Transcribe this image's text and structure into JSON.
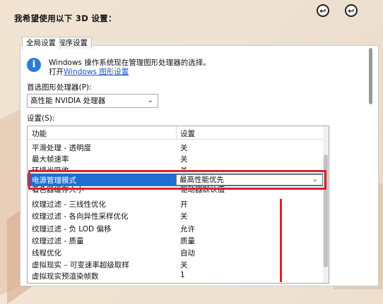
{
  "header": {
    "title": "我希望使用以下 3D 设置："
  },
  "tabs": [
    {
      "label": "全局设置",
      "active": true
    },
    {
      "label": "程序设置",
      "active": false
    }
  ],
  "info": {
    "line1": "Windows 操作系统现在管理图形处理器的选择。",
    "line2_prefix": "打开",
    "line2_link": "Windows 图形设置"
  },
  "preferred_gpu": {
    "label": "首选图形处理器(P):",
    "value": "高性能 NVIDIA 处理器"
  },
  "settings": {
    "label": "设置(S):",
    "col_feature": "功能",
    "col_setting": "设置",
    "rows": [
      {
        "feature": "平滑处理 - 透明度",
        "value": "关"
      },
      {
        "feature": "最大帧速率",
        "value": "关"
      },
      {
        "feature": "环境光吸收",
        "value": "关"
      },
      {
        "feature": "电源管理模式",
        "value": "最高性能优先",
        "selected": true
      },
      {
        "feature": "着色器缓存大小",
        "value": "驱动器默认值"
      },
      {
        "feature": "纹理过滤 - 三线性优化",
        "value": "开"
      },
      {
        "feature": "纹理过滤 - 各向异性采样优化",
        "value": "关"
      },
      {
        "feature": "纹理过滤 - 负 LOD 偏移",
        "value": "允许"
      },
      {
        "feature": "纹理过滤 - 质量",
        "value": "质量"
      },
      {
        "feature": "线程优化",
        "value": "自动"
      },
      {
        "feature": "虚拟现实 – 可变速率超级取样",
        "value": "关"
      },
      {
        "feature": "虚拟现实预渲染帧数",
        "value": "1"
      }
    ]
  },
  "colors": {
    "selection": "#1f6fd1",
    "highlight": "#e0202a",
    "link": "#1a56c8"
  },
  "icons": {
    "info": "info-icon",
    "dropdown": "chevron-down-icon",
    "corner": "back-circle-icon"
  }
}
